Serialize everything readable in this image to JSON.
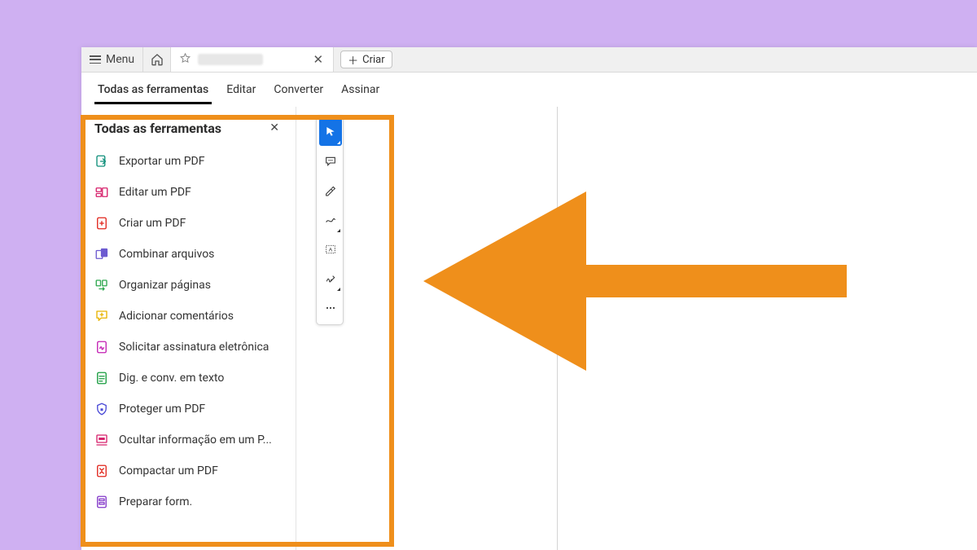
{
  "titlebar": {
    "menu_label": "Menu",
    "create_label": "Criar"
  },
  "tabs": {
    "items": [
      {
        "label": "Todas as ferramentas"
      },
      {
        "label": "Editar"
      },
      {
        "label": "Converter"
      },
      {
        "label": "Assinar"
      }
    ]
  },
  "panel": {
    "title": "Todas as ferramentas",
    "tools": [
      {
        "label": "Exportar um PDF",
        "icon": "export-pdf-icon",
        "color": "#0f8f7a"
      },
      {
        "label": "Editar um PDF",
        "icon": "edit-pdf-icon",
        "color": "#d6226c"
      },
      {
        "label": "Criar um PDF",
        "icon": "create-pdf-icon",
        "color": "#e1251b"
      },
      {
        "label": "Combinar arquivos",
        "icon": "combine-files-icon",
        "color": "#6d5bd0"
      },
      {
        "label": "Organizar páginas",
        "icon": "organize-pages-icon",
        "color": "#2fa84f"
      },
      {
        "label": "Adicionar comentários",
        "icon": "add-comments-icon",
        "color": "#e8b300"
      },
      {
        "label": "Solicitar assinatura eletrônica",
        "icon": "request-esign-icon",
        "color": "#c21fb3"
      },
      {
        "label": "Dig. e conv. em texto",
        "icon": "scan-ocr-icon",
        "color": "#179c3e"
      },
      {
        "label": "Proteger um PDF",
        "icon": "protect-pdf-icon",
        "color": "#4a4ad6"
      },
      {
        "label": "Ocultar informação em um P...",
        "icon": "redact-icon",
        "color": "#d6226c"
      },
      {
        "label": "Compactar um PDF",
        "icon": "compress-pdf-icon",
        "color": "#e1251b"
      },
      {
        "label": "Preparar form.",
        "icon": "prepare-form-icon",
        "color": "#8338c9"
      }
    ]
  },
  "quickbar": {
    "items": [
      {
        "icon": "cursor-icon",
        "active": true
      },
      {
        "icon": "comment-icon",
        "active": false
      },
      {
        "icon": "highlight-icon",
        "active": false
      },
      {
        "icon": "draw-icon",
        "active": false
      },
      {
        "icon": "text-select-icon",
        "active": false
      },
      {
        "icon": "sign-icon",
        "active": false
      },
      {
        "icon": "more-icon",
        "active": false
      }
    ]
  },
  "annotations": {
    "highlight_color": "#ef8f1b",
    "arrow_color": "#ef8f1b"
  }
}
